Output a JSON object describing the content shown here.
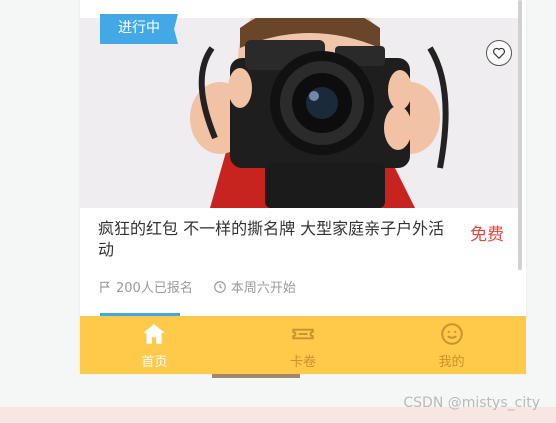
{
  "card": {
    "status_tag": "进行中",
    "title": "疯狂的红包 不一样的撕名牌 大型家庭亲子户外活动",
    "price": "免费",
    "signups": "200人已报名",
    "start_time": "本周六开始"
  },
  "tabbar": {
    "items": [
      {
        "label": "首页",
        "icon": "home-icon",
        "active": true
      },
      {
        "label": "卡卷",
        "icon": "ticket-icon",
        "active": false
      },
      {
        "label": "我的",
        "icon": "smile-icon",
        "active": false
      }
    ]
  },
  "watermark": "CSDN @mistys_city",
  "colors": {
    "accent": "#43a9e6",
    "price": "#e8453c",
    "tabbar": "#ffc94a",
    "tab_inactive": "#c8932a"
  }
}
